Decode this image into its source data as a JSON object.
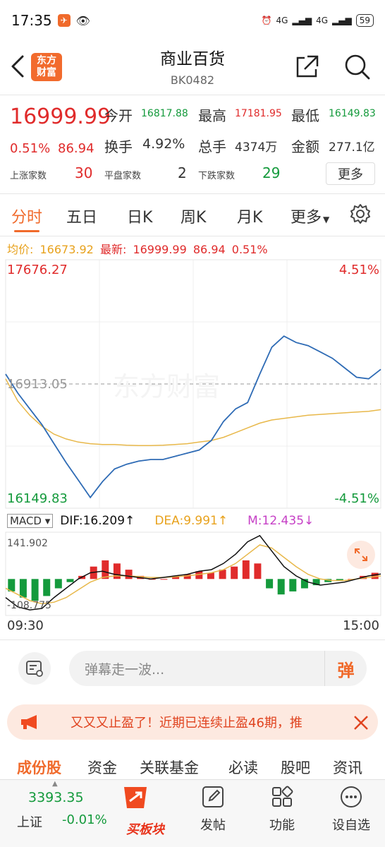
{
  "status": {
    "time": "17:35",
    "battery": "59",
    "network": "4G"
  },
  "header": {
    "logo_line1": "东方",
    "logo_line2": "财富",
    "title": "商业百货",
    "code": "BK0482"
  },
  "quote": {
    "price": "16999.99",
    "change_pct": "0.51%",
    "change_val": "86.94",
    "open_label": "今开",
    "open_value": "16817.88",
    "high_label": "最高",
    "high_value": "17181.95",
    "low_label": "最低",
    "low_value": "16149.83",
    "turnover_label": "换手",
    "turnover_value": "4.92%",
    "volume_label": "总手",
    "volume_value": "4374万",
    "amount_label": "金额",
    "amount_value": "277.1亿",
    "up_label": "上涨家数",
    "up_count": "30",
    "flat_label": "平盘家数",
    "flat_count": "2",
    "down_label": "下跌家数",
    "down_count": "29",
    "more_label": "更多"
  },
  "tabs": [
    "分时",
    "五日",
    "日K",
    "周K",
    "月K",
    "更多"
  ],
  "info_line": {
    "avg_label": "均价:",
    "avg_value": "16673.92",
    "latest_label": "最新:",
    "latest_value": "16999.99",
    "latest_chg": "86.94",
    "latest_pct": "0.51%"
  },
  "chart_data": [
    {
      "type": "line",
      "title": "",
      "y_top_label": "17676.27",
      "y_bottom_label": "16149.83",
      "y_mid_label": "16913.05",
      "pct_top_label": "4.51%",
      "pct_bottom_label": "-4.51%",
      "ylim": [
        16149.83,
        17676.27
      ],
      "x_start_label": "09:30",
      "x_end_label": "15:00",
      "grid": true,
      "series": [
        {
          "name": "最新",
          "color": "#2e6bb5",
          "values": [
            16980,
            16860,
            16760,
            16660,
            16540,
            16420,
            16310,
            16200,
            16300,
            16380,
            16410,
            16430,
            16440,
            16440,
            16460,
            16480,
            16500,
            16560,
            16680,
            16760,
            16800,
            16980,
            17150,
            17220,
            17180,
            17160,
            17120,
            17080,
            17020,
            16960,
            16950,
            17010
          ]
        },
        {
          "name": "均价",
          "color": "#e8b84a",
          "values": [
            16950,
            16810,
            16720,
            16650,
            16600,
            16570,
            16550,
            16540,
            16535,
            16535,
            16530,
            16528,
            16528,
            16530,
            16535,
            16540,
            16550,
            16560,
            16580,
            16610,
            16640,
            16670,
            16690,
            16700,
            16710,
            16720,
            16725,
            16730,
            16735,
            16740,
            16745,
            16755
          ]
        }
      ]
    },
    {
      "type": "bar",
      "title": "MACD",
      "dif_label": "DIF:16.209↑",
      "dea_label": "DEA:9.991↑",
      "m_label": "M:12.435↓",
      "y_top_label": "141.902",
      "y_bottom_label": "-108.775",
      "ylim": [
        -108.775,
        141.902
      ],
      "histogram": [
        -40,
        -60,
        -70,
        -55,
        -30,
        -10,
        10,
        40,
        60,
        50,
        30,
        10,
        0,
        0,
        10,
        15,
        25,
        20,
        30,
        40,
        60,
        50,
        -30,
        -50,
        -40,
        -30,
        -20,
        -10,
        -5,
        0,
        10,
        20
      ],
      "dif": [
        -60,
        -90,
        -100,
        -95,
        -60,
        -30,
        0,
        20,
        25,
        15,
        10,
        5,
        0,
        5,
        10,
        15,
        25,
        30,
        50,
        80,
        120,
        140,
        90,
        40,
        10,
        -10,
        -20,
        -15,
        -10,
        0,
        10,
        16
      ],
      "dea": [
        -30,
        -50,
        -70,
        -80,
        -75,
        -60,
        -35,
        -10,
        5,
        10,
        10,
        8,
        5,
        5,
        7,
        10,
        15,
        20,
        30,
        50,
        80,
        110,
        100,
        70,
        40,
        15,
        0,
        -5,
        -5,
        0,
        5,
        10
      ]
    }
  ],
  "danmu": {
    "placeholder": "弹幕走一波...",
    "button": "弹"
  },
  "notice": {
    "text": "又又又止盈了！近期已连续止盈46期，推"
  },
  "sub_tabs": [
    "成份股",
    "资金",
    "关联基金",
    "必读",
    "股吧",
    "资讯"
  ],
  "bottom_nav": {
    "index_value": "3393.35",
    "index_name": "上证",
    "index_chg": "-0.01%",
    "buy_label": "买板块",
    "post_label": "发帖",
    "func_label": "功能",
    "watch_label": "设自选",
    "peek_value": "3393.35"
  },
  "colors": {
    "accent": "#f06a2b",
    "up": "#e02b2b",
    "down": "#149a3c"
  }
}
